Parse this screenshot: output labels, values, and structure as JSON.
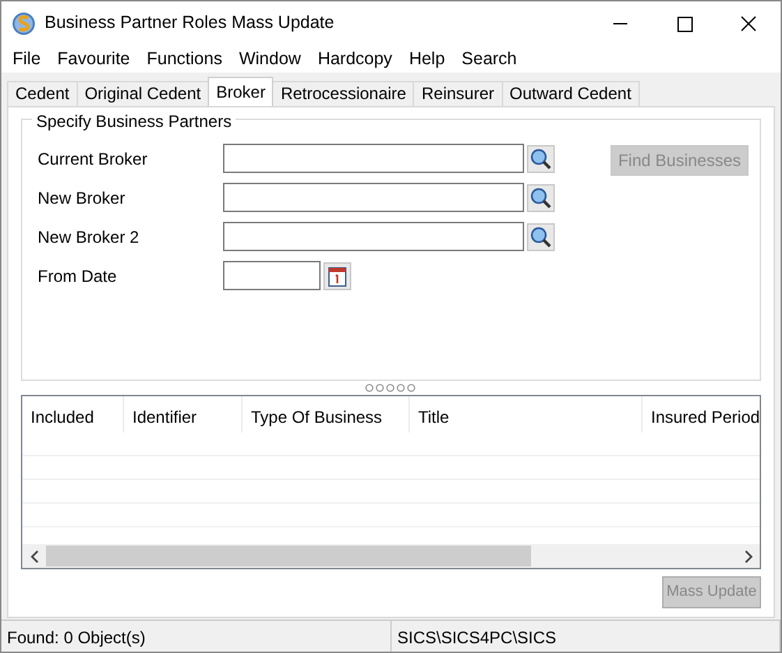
{
  "window": {
    "title": "Business Partner Roles Mass Update"
  },
  "menu": [
    "File",
    "Favourite",
    "Functions",
    "Window",
    "Hardcopy",
    "Help",
    "Search"
  ],
  "tabs": [
    {
      "label": "Cedent",
      "selected": false
    },
    {
      "label": "Original Cedent",
      "selected": false
    },
    {
      "label": "Broker",
      "selected": true
    },
    {
      "label": "Retrocessionaire",
      "selected": false
    },
    {
      "label": "Reinsurer",
      "selected": false
    },
    {
      "label": "Outward Cedent",
      "selected": false
    }
  ],
  "group": {
    "title": "Specify Business Partners",
    "fields": [
      {
        "label": "Current Broker",
        "kind": "lookup"
      },
      {
        "label": "New Broker",
        "kind": "lookup"
      },
      {
        "label": "New Broker 2",
        "kind": "lookup"
      },
      {
        "label": "From Date",
        "kind": "date"
      }
    ],
    "find_button": {
      "label": "Find Businesses",
      "disabled": true
    }
  },
  "table": {
    "columns": [
      "Included",
      "Identifier",
      "Type Of Business",
      "Title",
      "Insured Period"
    ]
  },
  "mass_update_button": {
    "label": "Mass Update",
    "disabled": true
  },
  "status_bar": [
    "Found: 0 Object(s)",
    "SICS\\SICS4PC\\SICS"
  ]
}
